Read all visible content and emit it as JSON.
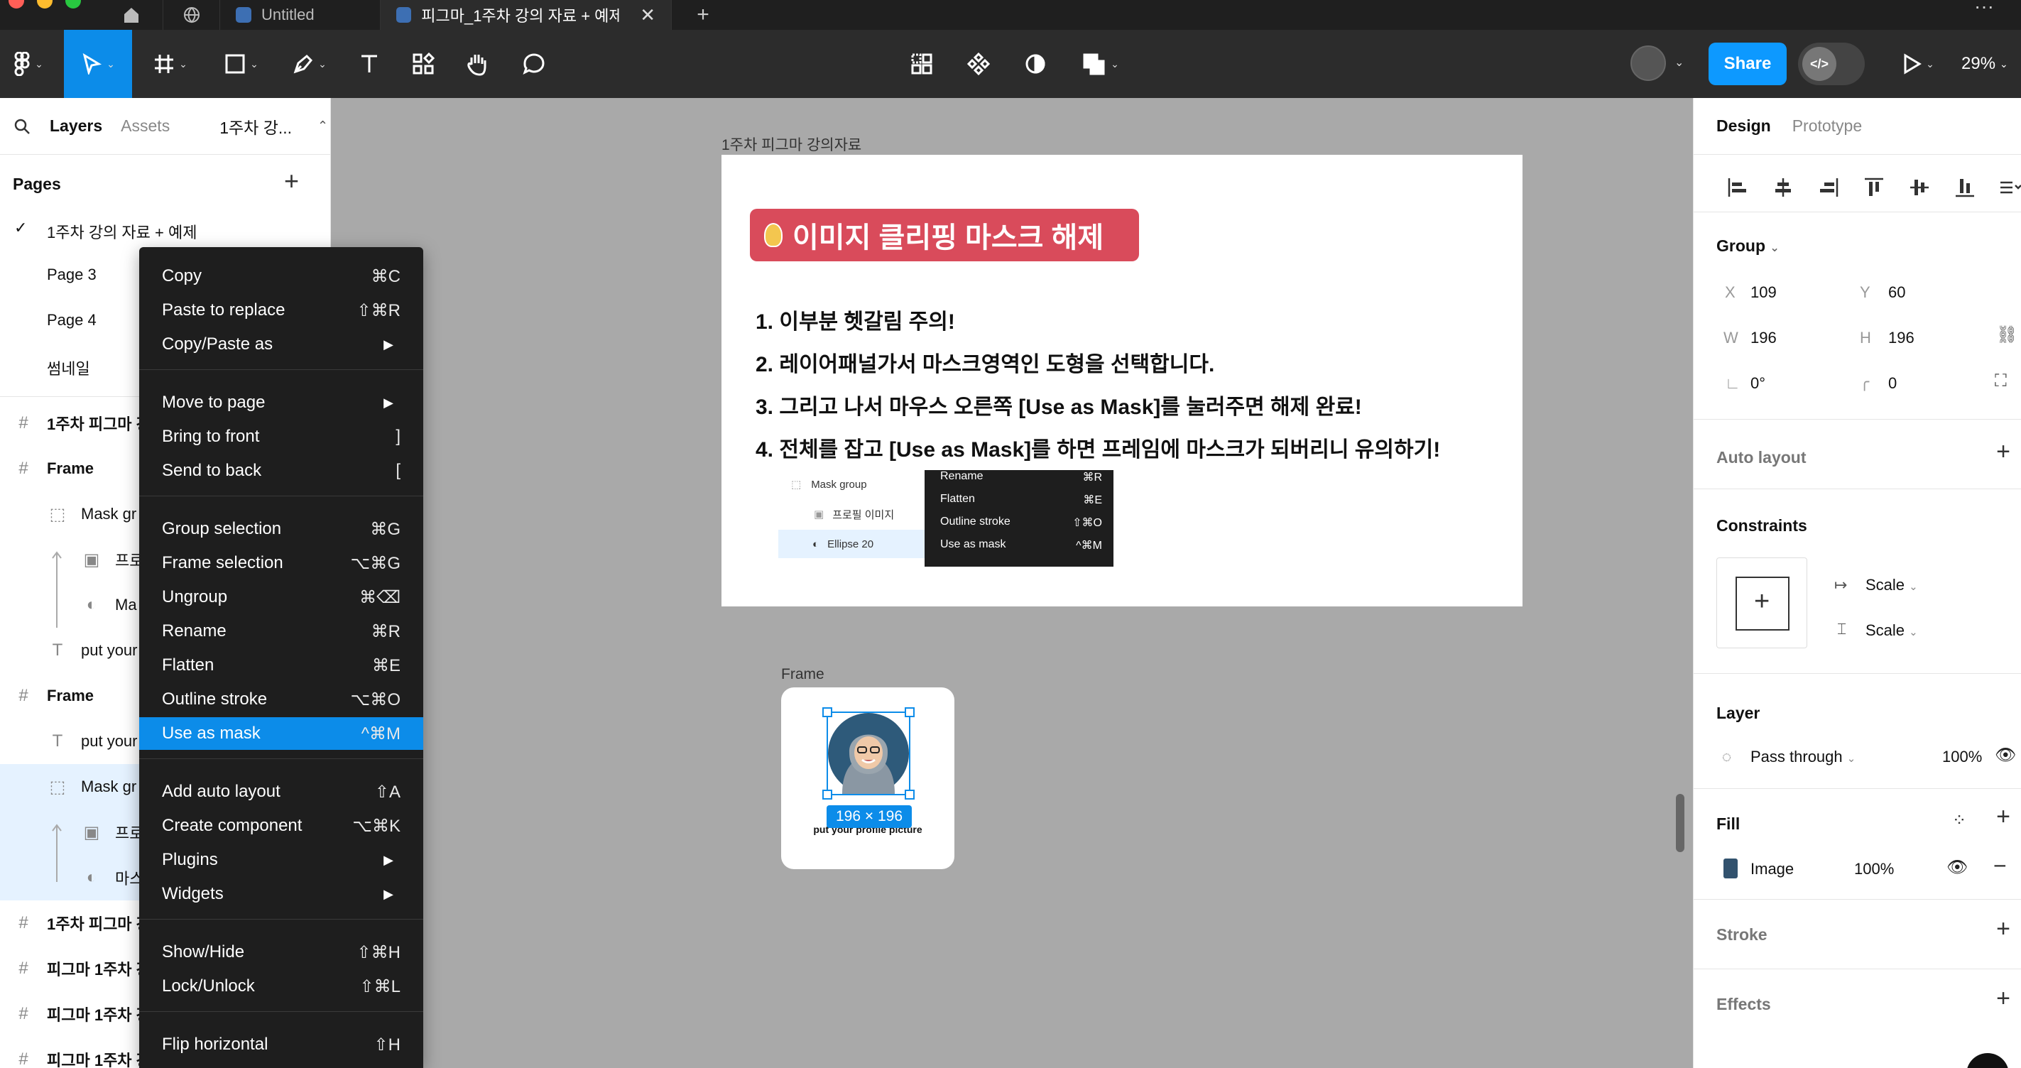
{
  "tabs": [
    {
      "label": "Untitled",
      "active": false
    },
    {
      "label": "피그마_1주차 강의 자료 + 예제",
      "active": true
    }
  ],
  "toolbar": {
    "share_label": "Share",
    "dev_label": "</>",
    "zoom": "29%"
  },
  "left_panel": {
    "tabs": {
      "layers": "Layers",
      "assets": "Assets",
      "page_select": "1주차 강..."
    },
    "pages_title": "Pages",
    "pages": [
      "1주차 강의 자료 + 예제",
      "Page 3",
      "Page 4",
      "썸네일"
    ],
    "layers": [
      {
        "name": "1주차 피그마 강",
        "icon": "#"
      },
      {
        "name": "Frame",
        "icon": "#"
      },
      {
        "name": "Mask gr",
        "icon": "mask"
      },
      {
        "name": "프로",
        "icon": "image"
      },
      {
        "name": "Ma",
        "icon": "ellipse"
      },
      {
        "name": "put your",
        "icon": "T"
      },
      {
        "name": "Frame",
        "icon": "#"
      },
      {
        "name": "put your",
        "icon": "T"
      },
      {
        "name": "Mask gr",
        "icon": "mask"
      },
      {
        "name": "프로",
        "icon": "image"
      },
      {
        "name": "마스",
        "icon": "ellipse"
      },
      {
        "name": "1주차 피그마 강",
        "icon": "#"
      },
      {
        "name": "피그마 1주차 강",
        "icon": "#"
      },
      {
        "name": "피그마 1주차 강",
        "icon": "#"
      },
      {
        "name": "피그마 1주차 강",
        "icon": "#"
      }
    ]
  },
  "context_menu": {
    "groups": [
      [
        {
          "label": "Copy",
          "shortcut": "⌘C"
        },
        {
          "label": "Paste to replace",
          "shortcut": "⇧⌘R"
        },
        {
          "label": "Copy/Paste as",
          "submenu": true
        }
      ],
      [
        {
          "label": "Move to page",
          "submenu": true
        },
        {
          "label": "Bring to front",
          "shortcut": "]"
        },
        {
          "label": "Send to back",
          "shortcut": "["
        }
      ],
      [
        {
          "label": "Group selection",
          "shortcut": "⌘G"
        },
        {
          "label": "Frame selection",
          "shortcut": "⌥⌘G"
        },
        {
          "label": "Ungroup",
          "shortcut": "⌘⌫"
        },
        {
          "label": "Rename",
          "shortcut": "⌘R"
        },
        {
          "label": "Flatten",
          "shortcut": "⌘E"
        },
        {
          "label": "Outline stroke",
          "shortcut": "⌥⌘O"
        },
        {
          "label": "Use as mask",
          "shortcut": "^⌘M",
          "active": true
        }
      ],
      [
        {
          "label": "Add auto layout",
          "shortcut": "⇧A"
        },
        {
          "label": "Create component",
          "shortcut": "⌥⌘K"
        },
        {
          "label": "Plugins",
          "submenu": true
        },
        {
          "label": "Widgets",
          "submenu": true
        }
      ],
      [
        {
          "label": "Show/Hide",
          "shortcut": "⇧⌘H"
        },
        {
          "label": "Lock/Unlock",
          "shortcut": "⇧⌘L"
        }
      ],
      [
        {
          "label": "Flip horizontal",
          "shortcut": "⇧H"
        }
      ]
    ]
  },
  "canvas": {
    "doc_frame_label": "1주차 피그마 강의자료",
    "callout_title": "이미지 클리핑 마스크 해제",
    "steps": [
      "1. 이부분 헷갈림 주의!",
      "2. 레이어패널가서 마스크영역인 도형을 선택합니다.",
      "3. 그리고 나서 마우스 오른쪽 [Use as Mask]를 눌러주면 해제 완료!",
      "4. 전체를 잡고 [Use as Mask]를 하면 프레임에 마스크가 되버리니 유의하기!"
    ],
    "mini_layers": [
      "Mask group",
      "프로필 이미지",
      "Ellipse 20"
    ],
    "mini_menu": [
      {
        "label": "Rename",
        "shortcut": "⌘R"
      },
      {
        "label": "Flatten",
        "shortcut": "⌘E"
      },
      {
        "label": "Outline stroke",
        "shortcut": "⇧⌘O"
      },
      {
        "label": "Use as mask",
        "shortcut": "^⌘M"
      }
    ],
    "profile_frame_label": "Frame",
    "selection_size": "196 × 196",
    "profile_caption": "put your profile picture"
  },
  "right_panel": {
    "tabs": {
      "design": "Design",
      "prototype": "Prototype"
    },
    "group_title": "Group",
    "x": "109",
    "y": "60",
    "w": "196",
    "h": "196",
    "rotation": "0°",
    "radius": "0",
    "labels": {
      "x": "X",
      "y": "Y",
      "w": "W",
      "h": "H"
    },
    "auto_layout": "Auto layout",
    "constraints": "Constraints",
    "constraint_h": "Scale",
    "constraint_v": "Scale",
    "layer_title": "Layer",
    "blend": "Pass through",
    "opacity": "100%",
    "fill_title": "Fill",
    "fill_type": "Image",
    "fill_opacity": "100%",
    "stroke_title": "Stroke",
    "effects_title": "Effects"
  },
  "colors": {
    "accent": "#0c8ce9",
    "share": "#0d99ff",
    "callout": "#d94b5b",
    "toolbar": "#2c2c2c",
    "canvas": "#a9a9a9"
  }
}
